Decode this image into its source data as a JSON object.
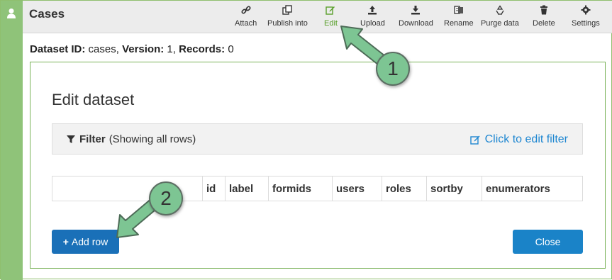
{
  "header": {
    "title": "Cases"
  },
  "toolbar": {
    "attach": "Attach",
    "publish_into": "Publish into",
    "edit": "Edit",
    "upload": "Upload",
    "download": "Download",
    "rename": "Rename",
    "purge_data": "Purge data",
    "delete": "Delete",
    "settings": "Settings"
  },
  "dataset_info": {
    "id_label": "Dataset ID:",
    "id_value": "cases,",
    "version_label": "Version:",
    "version_value": "1,",
    "records_label": "Records:",
    "records_value": "0"
  },
  "modal": {
    "title": "Edit dataset",
    "filter_label": "Filter",
    "filter_status": "(Showing all rows)",
    "filter_link": "Click to edit filter",
    "columns": [
      "",
      "id",
      "label",
      "formids",
      "users",
      "roles",
      "sortby",
      "enumerators"
    ],
    "add_row_label": "Add row",
    "close_label": "Close"
  },
  "callouts": {
    "one": "1",
    "two": "2"
  },
  "colors": {
    "accent_green": "#8fc379",
    "active_tool": "#5aa02c",
    "primary_button": "#1a70b8",
    "link": "#1f87d1",
    "callout_fill": "#7dc593"
  }
}
